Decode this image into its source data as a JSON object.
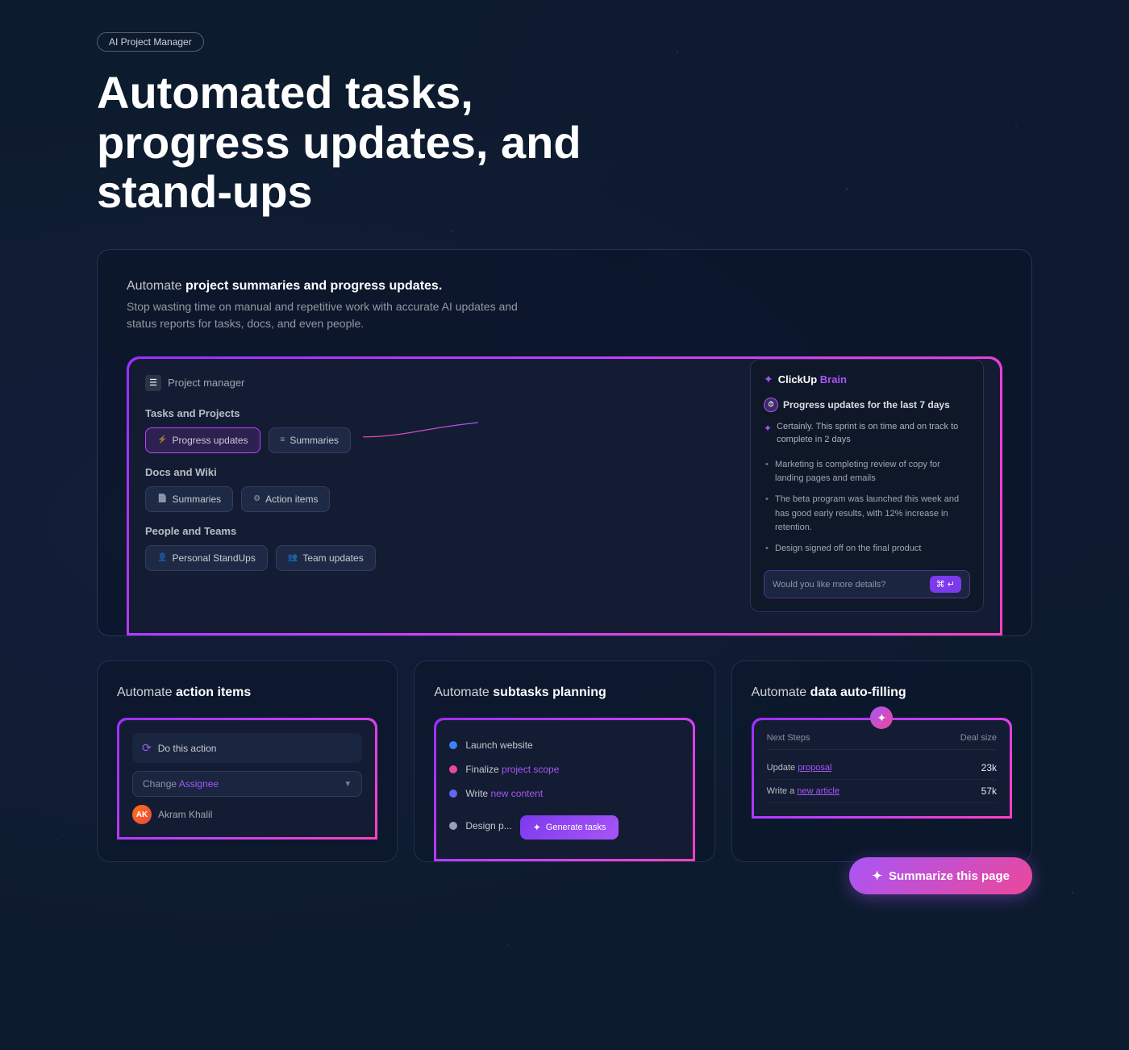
{
  "badge": {
    "label": "AI Project Manager"
  },
  "hero": {
    "title": "Automated tasks, progress updates, and stand-ups"
  },
  "main_feature": {
    "description_prefix": "Automate ",
    "description_bold": "project summaries and progress updates.",
    "subtitle": "Stop wasting time on manual and repetitive work with accurate AI updates and status reports for tasks, docs, and even people.",
    "demo": {
      "header_icon": "☰",
      "header_title": "Project manager",
      "tasks_section": "Tasks and Projects",
      "docs_section": "Docs and Wiki",
      "people_section": "People and Teams",
      "btn_progress": "Progress updates",
      "btn_summaries_tasks": "Summaries",
      "btn_summaries_docs": "Summaries",
      "btn_action": "Action items",
      "btn_standup": "Personal StandUps",
      "btn_team": "Team updates"
    },
    "brain": {
      "logo": "✦ ClickUp Brain",
      "query": "Progress updates for the last 7 days",
      "ai_response": "Certainly. This sprint is on time and on track to complete in 2 days",
      "bullets": [
        "Marketing is completing review of copy for landing pages and emails",
        "The beta program was launched this week and has good early results, with 12% increase in retention.",
        "Design signed off on the final product"
      ],
      "input_placeholder": "Would you like more details?",
      "send_label": "⌘ ↵"
    }
  },
  "cards": [
    {
      "title_prefix": "Automate ",
      "title_bold": "action items",
      "demo": {
        "action_label": "Do this action",
        "change_label": "Change",
        "field_label": "Assignee",
        "user_name": "Akram Khalil"
      }
    },
    {
      "title_prefix": "Automate ",
      "title_bold": "subtasks planning",
      "demo": {
        "items": [
          {
            "label": "Launch website",
            "color": "#3b82f6"
          },
          {
            "label": "Finalize project scope",
            "color": "#ec4899",
            "highlight": "project scope"
          },
          {
            "label": "Write new content",
            "color": "#6366f1",
            "highlight": "new content"
          },
          {
            "label": "Design p...",
            "color": "#94a3b8"
          }
        ],
        "generate_btn": "Generate tasks"
      }
    },
    {
      "title_prefix": "Automate ",
      "title_bold": "data auto-filling",
      "demo": {
        "col1": "Next Steps",
        "col2": "Deal size",
        "rows": [
          {
            "col1": "Update proposal",
            "col2": "23k",
            "col1_highlight": "proposal"
          },
          {
            "col1": "Write a new article",
            "col2": "57k",
            "col1_highlight": "new article"
          }
        ]
      }
    }
  ],
  "summarize_btn": {
    "label": "Summarize this page",
    "icon": "✦"
  }
}
